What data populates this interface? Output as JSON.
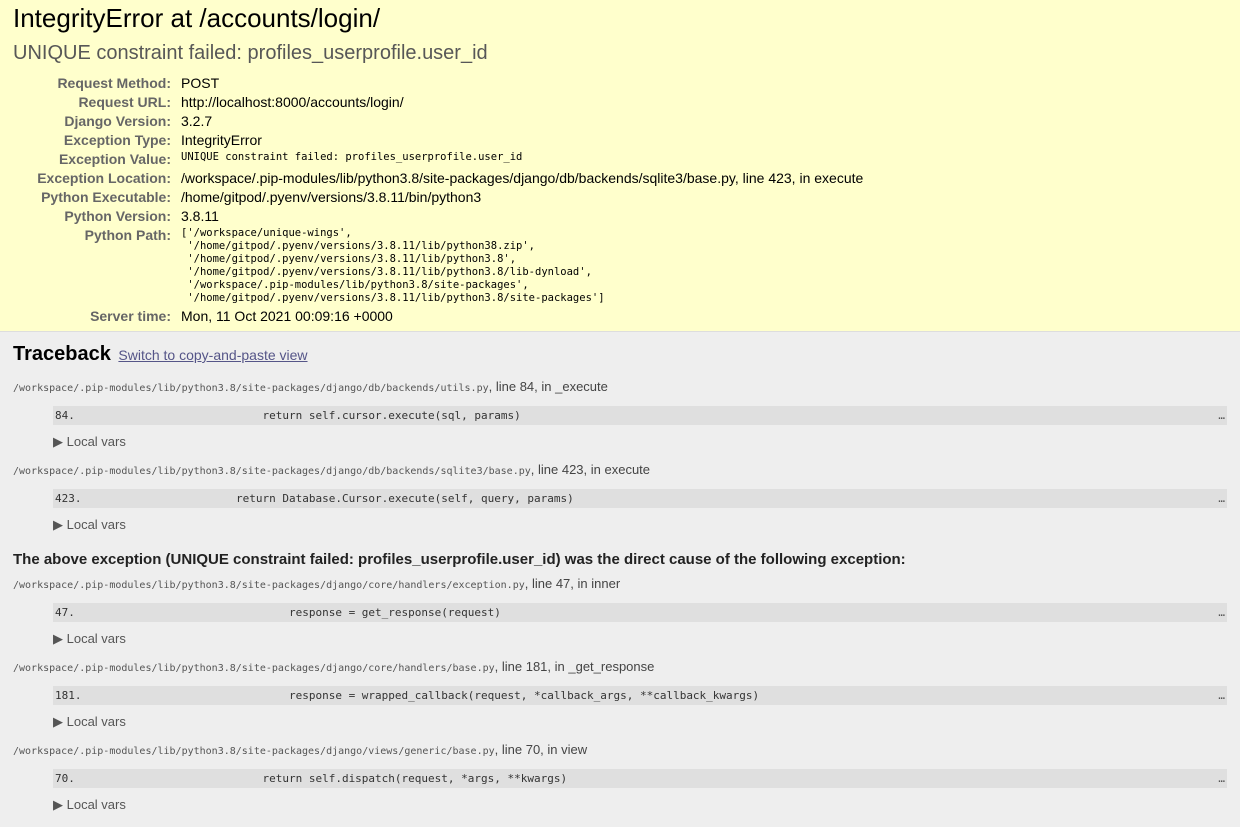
{
  "summary": {
    "title": "IntegrityError at /accounts/login/",
    "subtitle": "UNIQUE constraint failed: profiles_userprofile.user_id",
    "meta": {
      "request_method_label": "Request Method:",
      "request_method": "POST",
      "request_url_label": "Request URL:",
      "request_url": "http://localhost:8000/accounts/login/",
      "django_version_label": "Django Version:",
      "django_version": "3.2.7",
      "exception_type_label": "Exception Type:",
      "exception_type": "IntegrityError",
      "exception_value_label": "Exception Value:",
      "exception_value": "UNIQUE constraint failed: profiles_userprofile.user_id",
      "exception_location_label": "Exception Location:",
      "exception_location": "/workspace/.pip-modules/lib/python3.8/site-packages/django/db/backends/sqlite3/base.py, line 423, in execute",
      "python_executable_label": "Python Executable:",
      "python_executable": "/home/gitpod/.pyenv/versions/3.8.11/bin/python3",
      "python_version_label": "Python Version:",
      "python_version": "3.8.11",
      "python_path_label": "Python Path:",
      "python_path": "['/workspace/unique-wings',\n '/home/gitpod/.pyenv/versions/3.8.11/lib/python38.zip',\n '/home/gitpod/.pyenv/versions/3.8.11/lib/python3.8',\n '/home/gitpod/.pyenv/versions/3.8.11/lib/python3.8/lib-dynload',\n '/workspace/.pip-modules/lib/python3.8/site-packages',\n '/home/gitpod/.pyenv/versions/3.8.11/lib/python3.8/site-packages']",
      "server_time_label": "Server time:",
      "server_time": "Mon, 11 Oct 2021 00:09:16 +0000"
    }
  },
  "traceback": {
    "heading": "Traceback",
    "switch_link": "Switch to copy-and-paste view",
    "local_vars_label": "▶ Local vars",
    "frames_a": [
      {
        "file": "/workspace/.pip-modules/lib/python3.8/site-packages/django/db/backends/utils.py",
        "where": ", line 84, in _execute",
        "lineno": "84.",
        "code": "            return self.cursor.execute(sql, params)"
      },
      {
        "file": "/workspace/.pip-modules/lib/python3.8/site-packages/django/db/backends/sqlite3/base.py",
        "where": ", line 423, in execute",
        "lineno": "423.",
        "code": "        return Database.Cursor.execute(self, query, params)"
      }
    ],
    "cause_text": "The above exception (UNIQUE constraint failed: profiles_userprofile.user_id) was the direct cause of the following exception:",
    "frames_b": [
      {
        "file": "/workspace/.pip-modules/lib/python3.8/site-packages/django/core/handlers/exception.py",
        "where": ", line 47, in inner",
        "lineno": "47.",
        "code": "                response = get_response(request)"
      },
      {
        "file": "/workspace/.pip-modules/lib/python3.8/site-packages/django/core/handlers/base.py",
        "where": ", line 181, in _get_response",
        "lineno": "181.",
        "code": "                response = wrapped_callback(request, *callback_args, **callback_kwargs)"
      },
      {
        "file": "/workspace/.pip-modules/lib/python3.8/site-packages/django/views/generic/base.py",
        "where": ", line 70, in view",
        "lineno": "70.",
        "code": "            return self.dispatch(request, *args, **kwargs)"
      }
    ],
    "ellipsis": "…"
  }
}
